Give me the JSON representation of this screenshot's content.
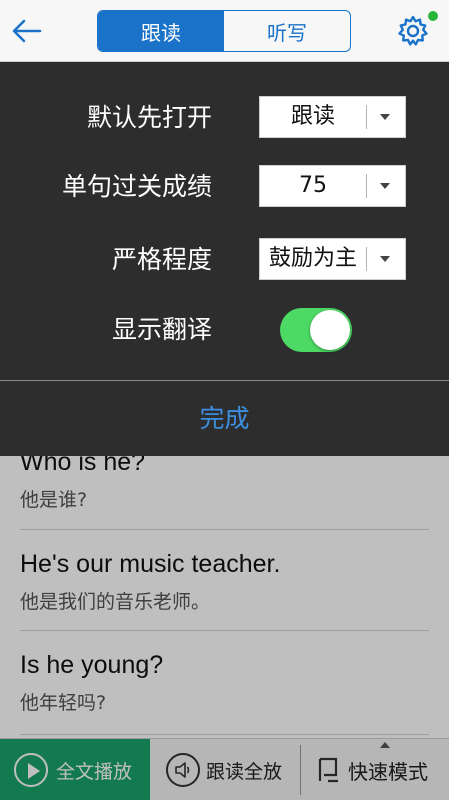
{
  "header": {
    "tabs": [
      {
        "label": "跟读",
        "active": true
      },
      {
        "label": "听写",
        "active": false
      }
    ],
    "accent_color": "#1a73c9",
    "notification_color": "#27b43a"
  },
  "settings": {
    "rows": [
      {
        "label": "默认先打开",
        "value": "跟读"
      },
      {
        "label": "单句过关成绩",
        "value": "75"
      },
      {
        "label": "严格程度",
        "value": "鼓励为主"
      }
    ],
    "translation": {
      "label": "显示翻译",
      "enabled": true
    },
    "done_label": "完成",
    "toggle_color": "#4cd964",
    "done_color": "#3c8fe0"
  },
  "sentences": [
    {
      "en": "Who is he?",
      "zh": "他是谁?"
    },
    {
      "en": "He's our music teacher.",
      "zh": "他是我们的音乐老师。"
    },
    {
      "en": "Is he young?",
      "zh": "他年轻吗?"
    }
  ],
  "bottombar": {
    "play_all": "全文播放",
    "follow_all": "跟读全放",
    "mode": "快速模式",
    "play_color": "#1aa36a"
  }
}
